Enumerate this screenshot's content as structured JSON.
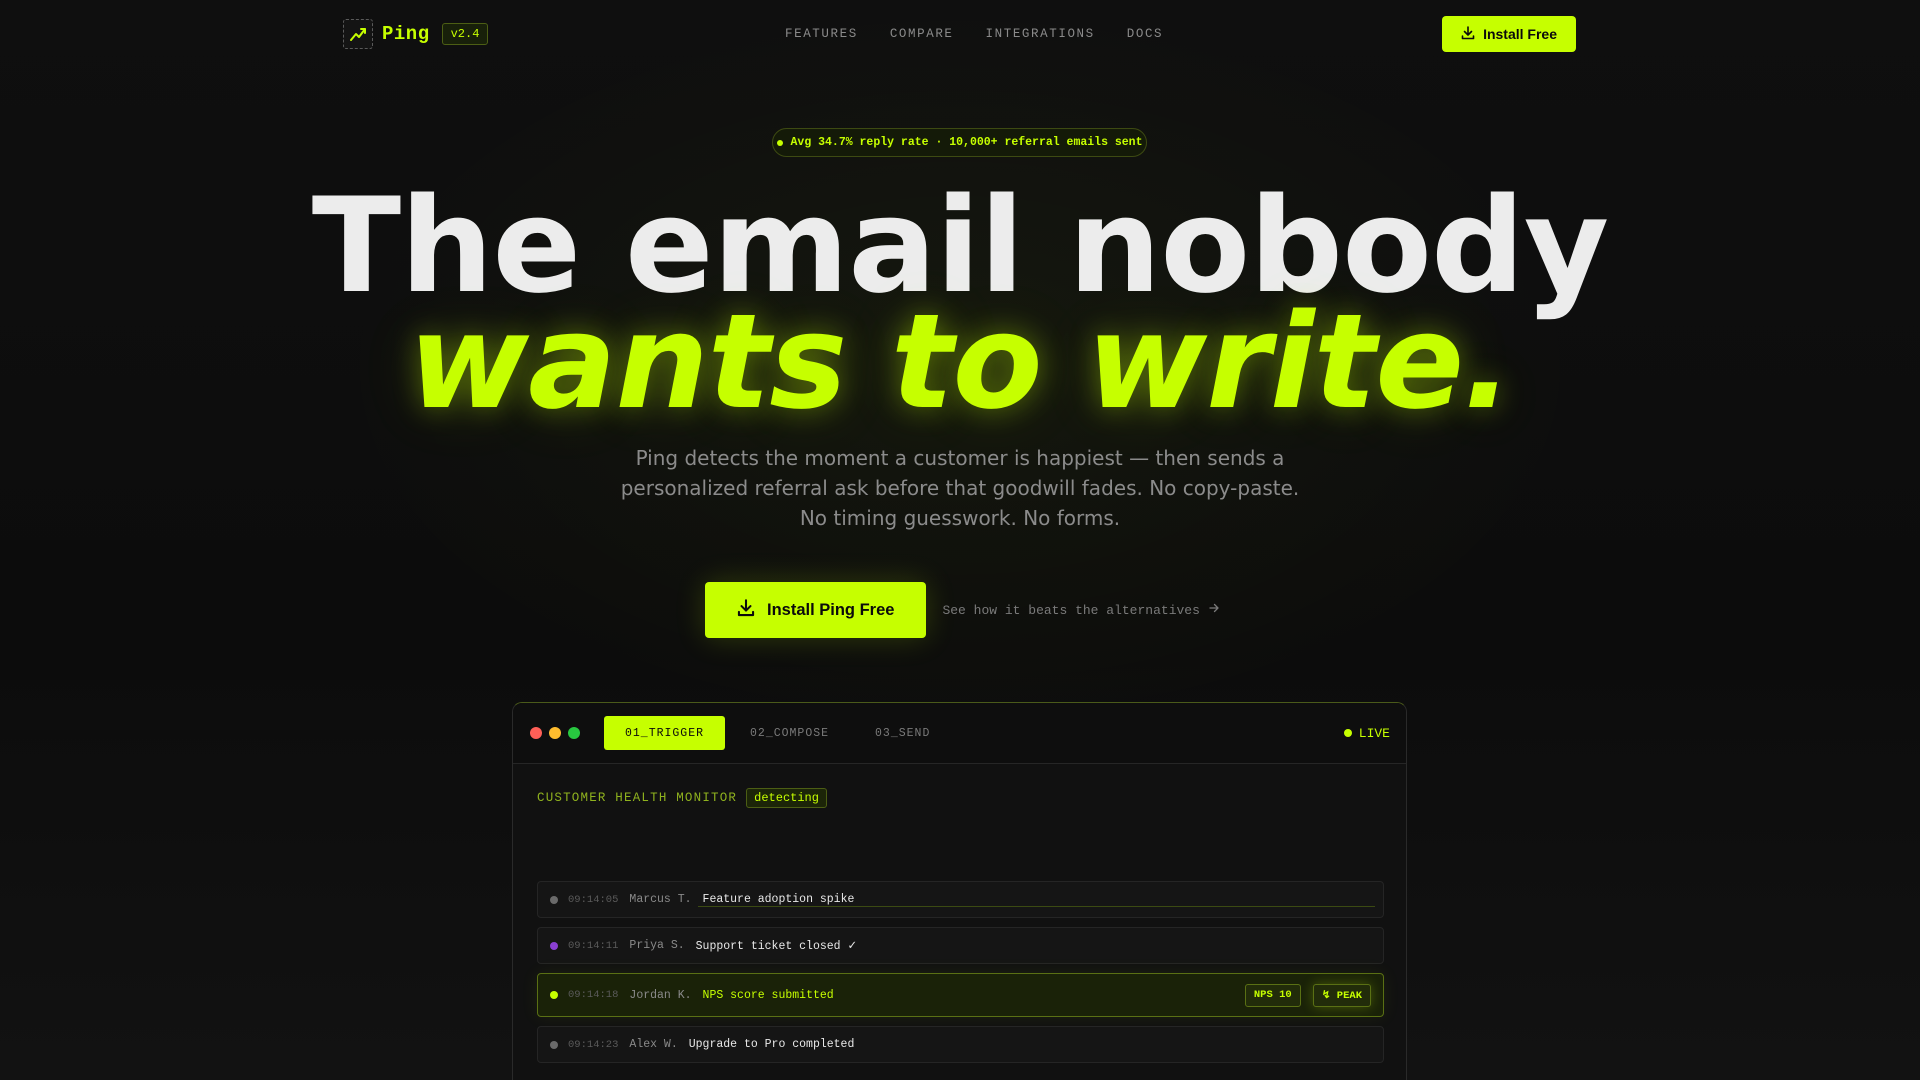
{
  "nav": {
    "brand_name": "Ping",
    "version": "v2.4",
    "logo_icon": "trending-up-icon",
    "links": [
      "FEATURES",
      "COMPARE",
      "INTEGRATIONS",
      "DOCS"
    ],
    "cta_label": "Install Free",
    "cta_icon": "download-icon"
  },
  "stat_pill": "Avg 34.7% reply rate · 10,000+ referral emails sent",
  "hero": {
    "line1": "The email nobody",
    "line2": "wants to write.",
    "subtitle": "Ping detects the moment a customer is happiest — then sends a personalized referral ask before that goodwill fades. No copy-paste. No timing guesswork. No forms."
  },
  "cta": {
    "primary_label": "Install Ping Free",
    "secondary_label": "See how it beats the alternatives",
    "secondary_icon": "arrow-right-icon"
  },
  "demo": {
    "tabs": [
      "01_TRIGGER",
      "02_COMPOSE",
      "03_SEND"
    ],
    "active_tab": 0,
    "live_label": "LIVE",
    "monitor_title": "CUSTOMER HEALTH MONITOR",
    "monitor_status": "detecting",
    "events": [
      {
        "time": "09:14:05",
        "name": "Marcus T.",
        "action": "Feature adoption spike",
        "dot": "#6a6a6a"
      },
      {
        "time": "09:14:11",
        "name": "Priya S.",
        "action": "Support ticket closed ✓",
        "dot": "#8a3fd1"
      },
      {
        "time": "09:14:18",
        "name": "Jordan K.",
        "action": "NPS score submitted",
        "dot": "#c6ff00",
        "tags": [
          "NPS 10",
          "↯ PEAK"
        ]
      },
      {
        "time": "09:14:23",
        "name": "Alex W.",
        "action": "Upgrade to Pro completed",
        "dot": "#6a6a6a"
      }
    ]
  },
  "colors": {
    "accent": "#c6ff00",
    "background": "#0d0d0d",
    "traffic_red": "#ff5f57",
    "traffic_yellow": "#febc2e",
    "traffic_green": "#28c840"
  }
}
